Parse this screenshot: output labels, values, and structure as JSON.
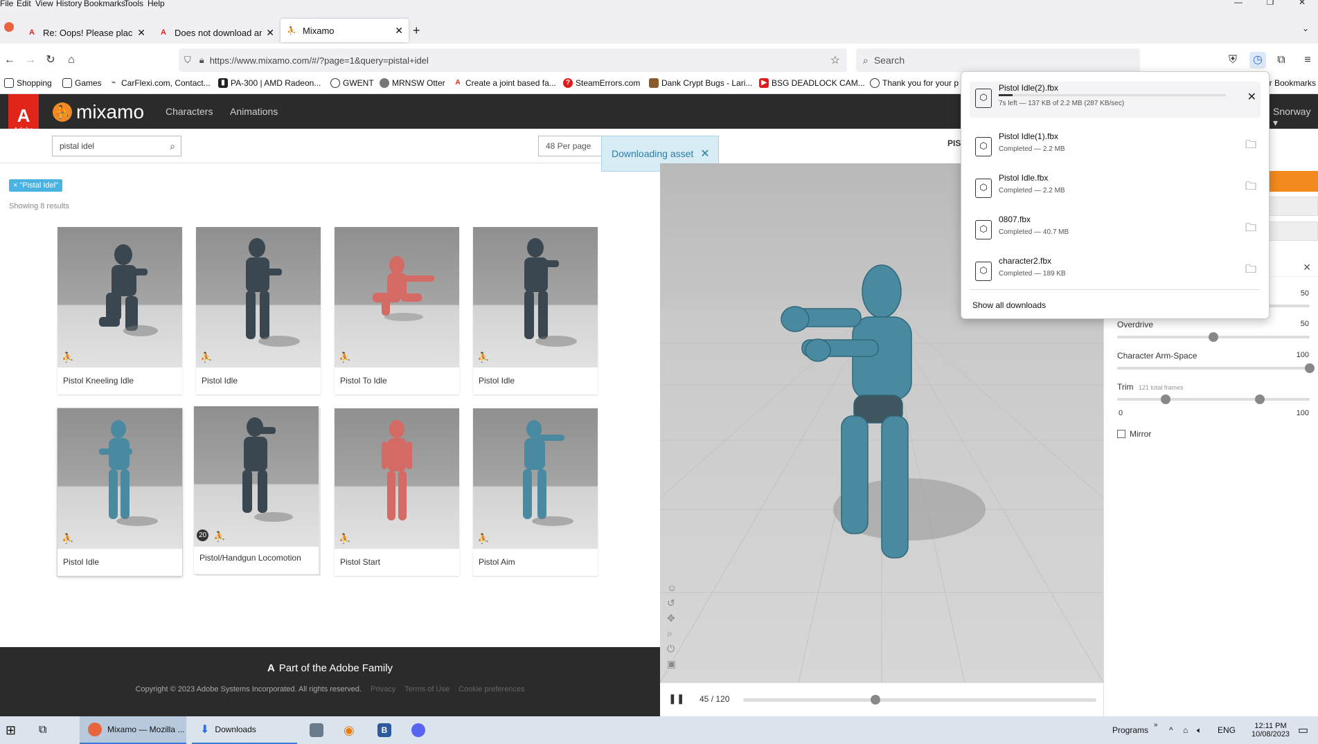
{
  "menu": [
    "File",
    "Edit",
    "View",
    "History",
    "Bookmarks",
    "Tools",
    "Help"
  ],
  "window_controls": [
    "—",
    "❐",
    "✕"
  ],
  "tabs": [
    {
      "title": "Re: Oops! Please place all marke",
      "icon": "adobe-icon"
    },
    {
      "title": "Does not download animation",
      "icon": "adobe-icon"
    },
    {
      "title": "Mixamo",
      "icon": "mixamo-icon"
    }
  ],
  "new_tab": "+",
  "url": "https://www.mixamo.com/#/?page=1&query=pistal+idel",
  "search_placeholder": "Search",
  "bookmarks": [
    "Shopping",
    "Games",
    "CarFlexi.com, Contact...",
    "PA-300 | AMD Radeon...",
    "GWENT",
    "MRNSW Otter",
    "Create a joint based fa...",
    "SteamErrors.com",
    "Dank Crypt Bugs - Lari...",
    "BSG DEADLOCK CAM...",
    "Thank you for your p",
    "er Bookmarks"
  ],
  "mixamo": {
    "brand": "mixamo",
    "adobe_badge": "Adobe",
    "nav": [
      "Characters",
      "Animations"
    ],
    "user_menu": "Snorway",
    "search_value": "pistal idel",
    "per_page": "48 Per page",
    "toast": "Downloading asset",
    "filter_tag": "\"Pistal Idel\"",
    "showing": "Showing 8 results",
    "selected_title": "PIST"
  },
  "cards": [
    {
      "label": "Pistol Kneeling Idle",
      "badge": ""
    },
    {
      "label": "Pistol Idle",
      "badge": ""
    },
    {
      "label": "Pistol To Idle",
      "badge": ""
    },
    {
      "label": "Pistol Idle",
      "badge": ""
    },
    {
      "label": "Pistol Idle",
      "badge": ""
    },
    {
      "label": "Pistol/Handgun Locomotion",
      "badge": "20"
    },
    {
      "label": "Pistol Start",
      "badge": ""
    },
    {
      "label": "Pistol Aim",
      "badge": ""
    }
  ],
  "footer": {
    "family": "Part of the Adobe Family",
    "copyright": "Copyright © 2023 Adobe Systems Incorporated. All rights reserved.",
    "links": [
      "Privacy",
      "Terms of Use",
      "Cookie preferences"
    ]
  },
  "player": {
    "frame": "45",
    "total": "/ 120",
    "progress": 0.375
  },
  "settings": {
    "sliders": [
      {
        "label": "",
        "value": "50",
        "level": 0.5
      },
      {
        "label": "Overdrive",
        "value": "50",
        "level": 0.5
      },
      {
        "label": "Character Arm-Space",
        "value": "100",
        "level": 1.0
      }
    ],
    "trim_label": "Trim",
    "trim_sub": "121 total frames",
    "trim_min": "0",
    "trim_max": "100",
    "trim_start": 0.25,
    "trim_end": 0.74,
    "mirror": "Mirror"
  },
  "downloads": {
    "items": [
      {
        "name": "Pistol Idle(2).fbx",
        "status": "7s left — 137 KB of 2.2 MB (287 KB/sec)",
        "action": "cancel",
        "progress": 0.06
      },
      {
        "name": "Pistol Idle(1).fbx",
        "status": "Completed — 2.2 MB",
        "action": "folder"
      },
      {
        "name": "Pistol Idle.fbx",
        "status": "Completed — 2.2 MB",
        "action": "folder"
      },
      {
        "name": "0807.fbx",
        "status": "Completed — 40.7 MB",
        "action": "folder"
      },
      {
        "name": "character2.fbx",
        "status": "Completed — 189 KB",
        "action": "folder"
      }
    ],
    "show_all": "Show all downloads"
  },
  "taskbar": {
    "apps": [
      "Mixamo — Mozilla ...",
      "Downloads"
    ],
    "programs": "Programs",
    "lang": "ENG",
    "time": "12:11 PM",
    "date": "10/08/2023"
  },
  "colors": {
    "accent_orange": "#f28a1d",
    "adobe_red": "#e1251b",
    "header_dark": "#2b2b2b",
    "tag_blue": "#4ab3e2"
  }
}
